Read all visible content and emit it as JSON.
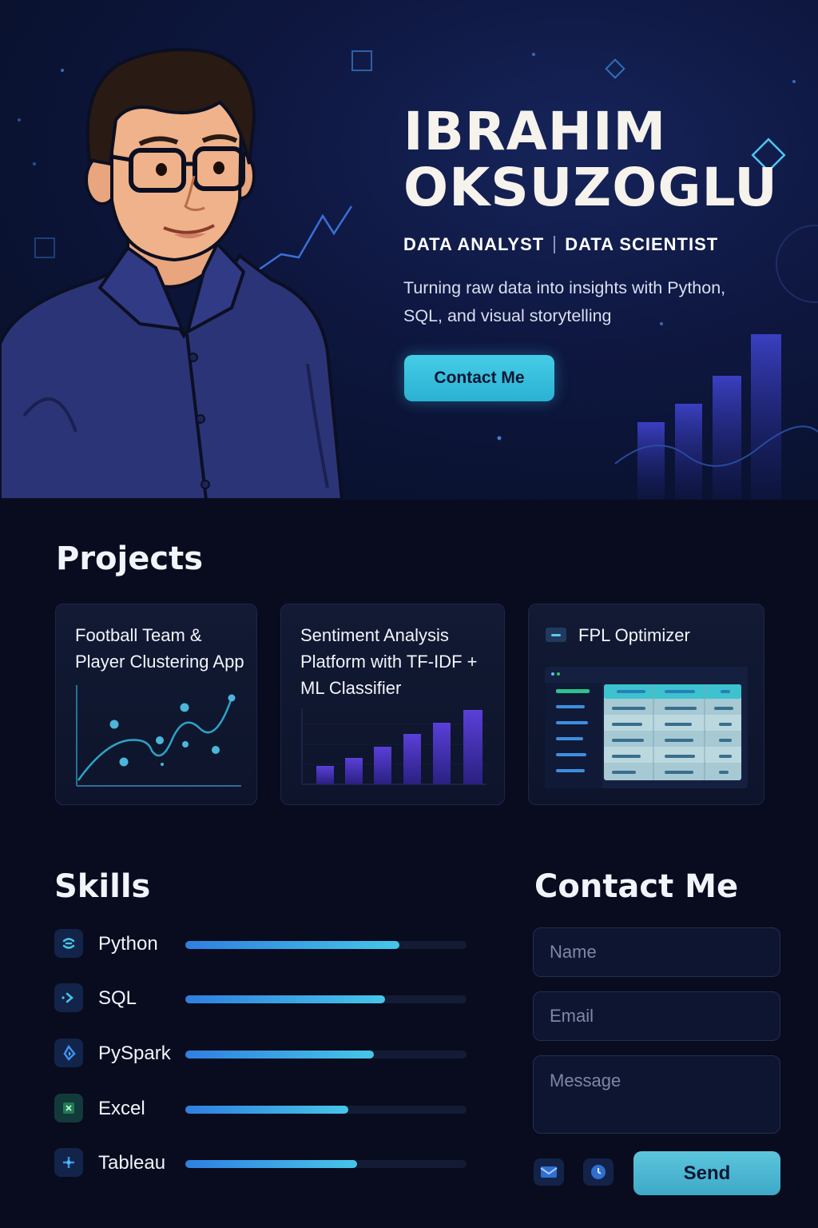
{
  "hero": {
    "name_first": "IBRAHIM",
    "name_last": "OKSUZOGLU",
    "role_1": "DATA ANALYST",
    "role_2": "DATA SCIENTIST",
    "tagline": "Turning raw data into insights with Python, SQL, and visual storytelling",
    "contact_button": "Contact Me"
  },
  "projects": {
    "title": "Projects",
    "items": [
      {
        "title": "Football Team & Player Clustering App",
        "visual": "scatter-line-chart-icon"
      },
      {
        "title": "Sentiment Analysis Platform with TF-IDF + ML Classifier",
        "visual": "bar-chart-icon"
      },
      {
        "title": "FPL Optimizer",
        "visual": "table-dashboard-icon"
      }
    ]
  },
  "skills": {
    "title": "Skills",
    "items": [
      {
        "label": "Python",
        "level": 0.76,
        "icon": "python-icon"
      },
      {
        "label": "SQL",
        "level": 0.71,
        "icon": "sql-icon"
      },
      {
        "label": "PySpark",
        "level": 0.67,
        "icon": "pyspark-icon"
      },
      {
        "label": "Excel",
        "level": 0.58,
        "icon": "excel-icon"
      },
      {
        "label": "Tableau",
        "level": 0.61,
        "icon": "tableau-icon"
      }
    ]
  },
  "contact": {
    "title": "Contact Me",
    "name_placeholder": "Name",
    "email_placeholder": "Email",
    "message_placeholder": "Message",
    "send_label": "Send"
  },
  "colors": {
    "background": "#080c1e",
    "accent": "#45cde6",
    "bar_gradient_start": "#2f7fe0",
    "bar_gradient_end": "#46c6e8"
  }
}
